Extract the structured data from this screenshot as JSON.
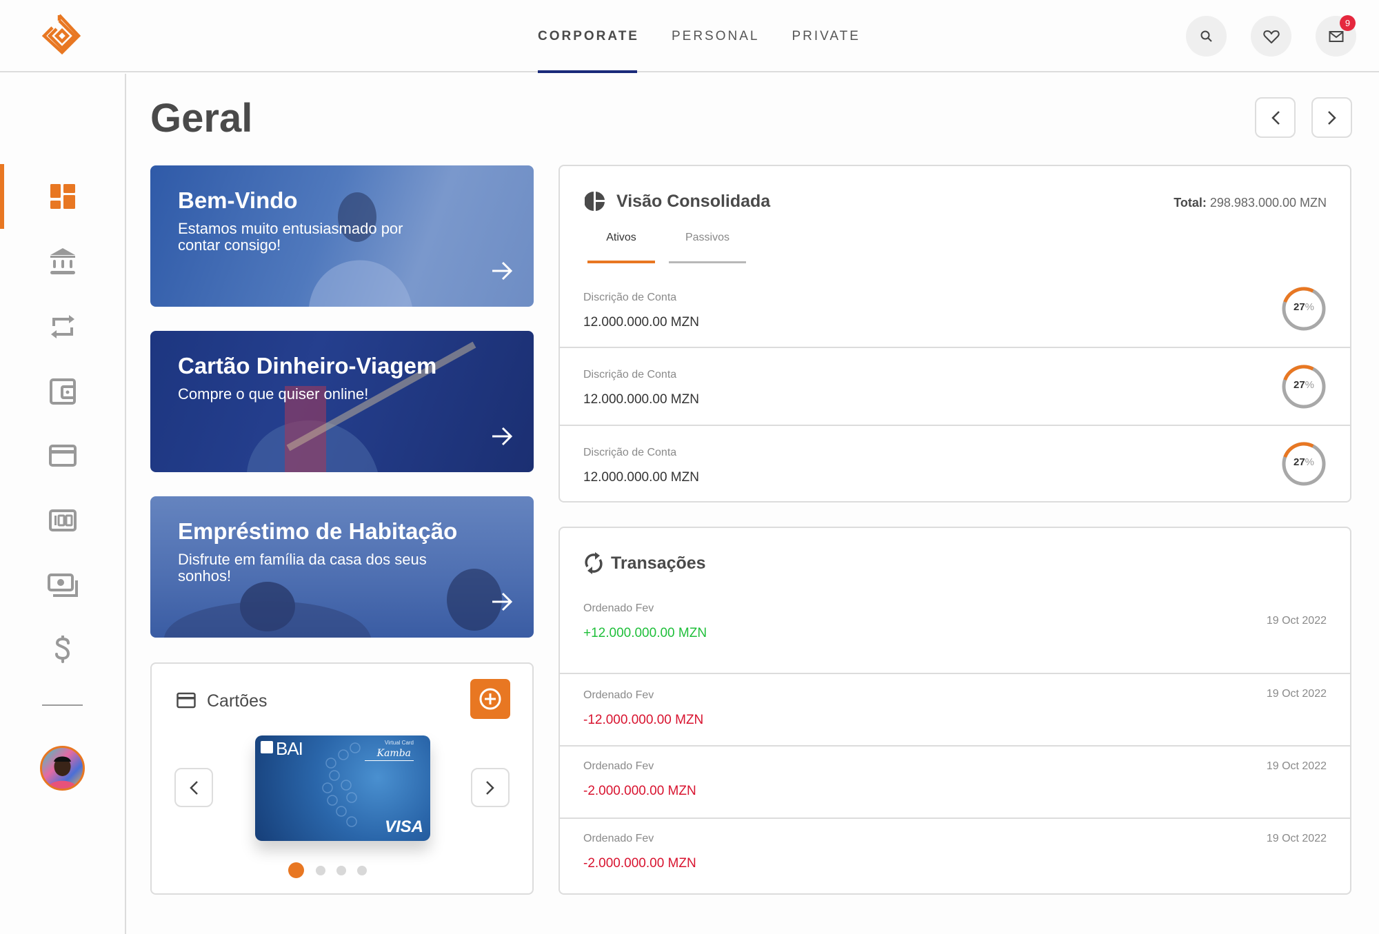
{
  "header": {
    "logo": "bank-logo",
    "nav_tabs": [
      {
        "label": "CORPORATE",
        "active": true
      },
      {
        "label": "PERSONAL",
        "active": false
      },
      {
        "label": "PRIVATE",
        "active": false
      }
    ],
    "actions": [
      {
        "icon": "search-icon"
      },
      {
        "icon": "heart-icon"
      },
      {
        "icon": "mail-icon",
        "badge": "9"
      }
    ]
  },
  "sidebar": {
    "items": [
      {
        "icon": "dashboard-icon",
        "active": true
      },
      {
        "icon": "bank-icon",
        "active": false
      },
      {
        "icon": "transfer-icon",
        "active": false
      },
      {
        "icon": "wallet-icon",
        "active": false
      },
      {
        "icon": "credit-card-icon",
        "active": false
      },
      {
        "icon": "counter-icon",
        "active": false
      },
      {
        "icon": "payments-icon",
        "active": false
      },
      {
        "icon": "dollar-icon",
        "active": false
      }
    ],
    "avatar": "user-avatar"
  },
  "page": {
    "title": "Geral"
  },
  "promos": [
    {
      "title": "Bem-Vindo",
      "subtitle": "Estamos muito entusiasmado por contar consigo!"
    },
    {
      "title": "Cartão Dinheiro-Viagem",
      "subtitle": "Compre o que quiser online!"
    },
    {
      "title": "Empréstimo de Habitação",
      "subtitle": "Disfrute em família da casa dos seus sonhos!"
    }
  ],
  "cards_panel": {
    "title": "Cartões",
    "card": {
      "bank": "BAI",
      "type_label": "Virtual Card",
      "signature": "Kamba",
      "network": "VISA"
    },
    "dots_total": 4,
    "dots_active": 1
  },
  "overview": {
    "title": "Visão Consolidada",
    "total_label": "Total:",
    "total_value": "298.983.000.00 MZN",
    "tabs": [
      {
        "label": "Ativos",
        "active": true
      },
      {
        "label": "Passivos",
        "active": false
      }
    ],
    "accounts": [
      {
        "label": "Discrição de Conta",
        "amount": "12.000.000.00 MZN",
        "percent": 27,
        "percent_text": "27",
        "percent_sign": "%"
      },
      {
        "label": "Discrição de Conta",
        "amount": "12.000.000.00 MZN",
        "percent": 27,
        "percent_text": "27",
        "percent_sign": "%"
      },
      {
        "label": "Discrição de Conta",
        "amount": "12.000.000.00 MZN",
        "percent": 27,
        "percent_text": "27",
        "percent_sign": "%"
      }
    ]
  },
  "transactions": {
    "title": "Transações",
    "items": [
      {
        "label": "Ordenado Fev",
        "amount": "+12.000.000.00 MZN",
        "date": "19 Oct 2022",
        "type": "credit"
      },
      {
        "label": "Ordenado Fev",
        "amount": "-12.000.000.00 MZN",
        "date": "19 Oct 2022",
        "type": "debit"
      },
      {
        "label": "Ordenado Fev",
        "amount": "-2.000.000.00 MZN",
        "date": "19 Oct 2022",
        "type": "debit"
      },
      {
        "label": "Ordenado Fev",
        "amount": "-2.000.000.00 MZN",
        "date": "19 Oct 2022",
        "type": "debit"
      }
    ]
  },
  "colors": {
    "accent": "#e87722",
    "nav_active": "#1a2a7a",
    "credit": "#1fbf3a",
    "debit": "#d8132f",
    "badge": "#e5283e"
  }
}
